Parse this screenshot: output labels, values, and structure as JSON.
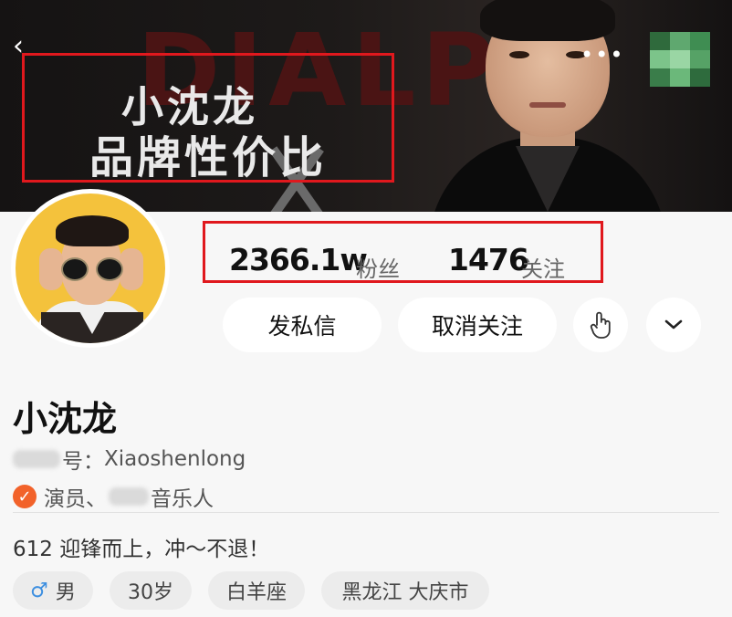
{
  "banner": {
    "deco_text": "DIALP",
    "title_line1": "小沈龙",
    "title_line2": "品牌性价比"
  },
  "stats": {
    "fans_value": "2366.1w",
    "fans_label": "粉丝",
    "following_value": "1476",
    "following_label": "关注"
  },
  "actions": {
    "message_label": "发私信",
    "unfollow_label": "取消关注"
  },
  "profile": {
    "name": "小沈龙",
    "id_prefix": "号：",
    "id_value": "Xiaoshenlong",
    "verify_left": "演员、",
    "verify_right": "音乐人",
    "bio": "612 迎锋而上，冲～不退！"
  },
  "tags": {
    "gender": "男",
    "gender_icon": "male-icon",
    "age": "30岁",
    "zodiac": "白羊座",
    "location": "黑龙江 大庆市"
  },
  "colors": {
    "highlight_border": "#e0181d",
    "verify_badge": "#f2622a",
    "male_icon": "#3d8fe0"
  }
}
